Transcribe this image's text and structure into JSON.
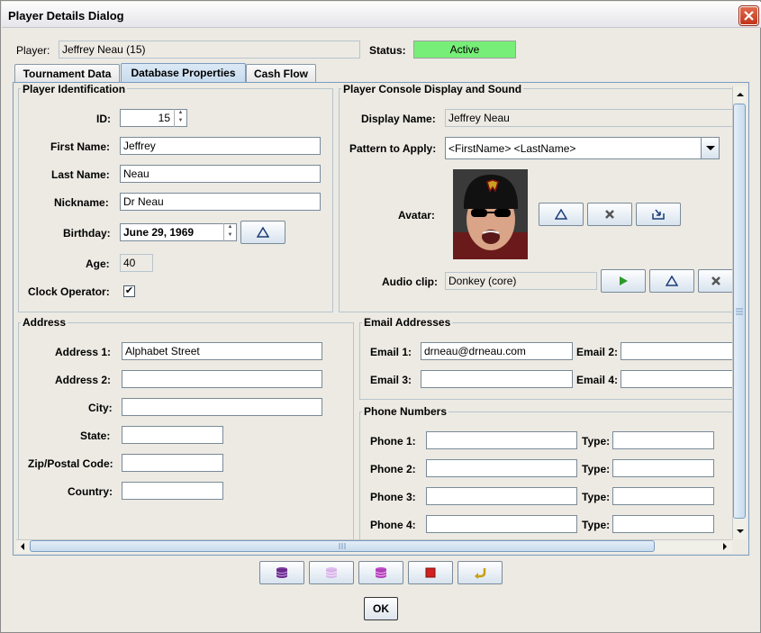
{
  "window": {
    "title": "Player Details Dialog"
  },
  "header": {
    "player_label": "Player:",
    "player_value": "Jeffrey Neau (15)",
    "status_label": "Status:",
    "status_value": "Active",
    "status_color": "#77ee77"
  },
  "tabs": [
    {
      "label": "Tournament Data",
      "selected": false
    },
    {
      "label": "Database Properties",
      "selected": true
    },
    {
      "label": "Cash Flow",
      "selected": false
    }
  ],
  "identification": {
    "title": "Player Identification",
    "id_label": "ID:",
    "id_value": "15",
    "first_label": "First Name:",
    "first_value": "Jeffrey",
    "last_label": "Last Name:",
    "last_value": "Neau",
    "nick_label": "Nickname:",
    "nick_value": "Dr Neau",
    "birthday_label": "Birthday:",
    "birthday_value": "June 29, 1969",
    "age_label": "Age:",
    "age_value": "40",
    "clock_label": "Clock Operator:",
    "clock_checked": true
  },
  "console": {
    "title": "Player Console Display and Sound",
    "display_label": "Display Name:",
    "display_value": "Jeffrey Neau",
    "pattern_label": "Pattern to Apply:",
    "pattern_value": "<FirstName> <LastName>",
    "avatar_label": "Avatar:",
    "audio_label": "Audio clip:",
    "audio_value": "Donkey (core)"
  },
  "address": {
    "title": "Address",
    "address1_label": "Address 1:",
    "address1_value": "Alphabet Street",
    "address2_label": "Address 2:",
    "address2_value": "",
    "city_label": "City:",
    "city_value": "",
    "state_label": "State:",
    "state_value": "",
    "zip_label": "Zip/Postal Code:",
    "zip_value": "",
    "country_label": "Country:",
    "country_value": ""
  },
  "email": {
    "title": "Email Addresses",
    "email1_label": "Email 1:",
    "email1_value": "drneau@drneau.com",
    "email2_label": "Email 2:",
    "email2_value": "",
    "email3_label": "Email 3:",
    "email3_value": "",
    "email4_label": "Email 4:",
    "email4_value": ""
  },
  "phones": {
    "title": "Phone Numbers",
    "rows": [
      {
        "label": "Phone 1:",
        "value": "",
        "type_label": "Type:",
        "type_value": ""
      },
      {
        "label": "Phone 2:",
        "value": "",
        "type_label": "Type:",
        "type_value": ""
      },
      {
        "label": "Phone 3:",
        "value": "",
        "type_label": "Type:",
        "type_value": ""
      },
      {
        "label": "Phone 4:",
        "value": "",
        "type_label": "Type:",
        "type_value": ""
      }
    ]
  },
  "toolbar_icons": [
    "database-icon",
    "database-light-icon",
    "database-pink-icon",
    "stop-icon",
    "undo-icon"
  ],
  "footer": {
    "ok_label": "OK"
  }
}
